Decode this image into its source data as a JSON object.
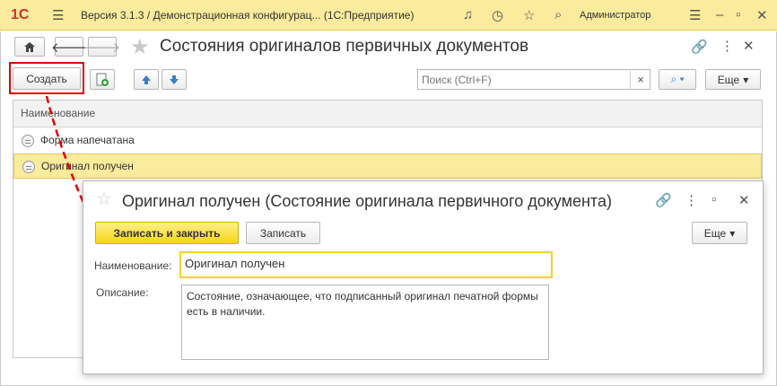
{
  "titlebar": {
    "logo": "1С",
    "title": "Версия 3.1.3 / Демонстрационная конфигурац...  (1С:Предприятие)",
    "user": "Администратор"
  },
  "page": {
    "title": "Состояния оригиналов первичных документов",
    "create_label": "Создать",
    "more_label": "Еще",
    "search_placeholder": "Поиск (Ctrl+F)",
    "clear_label": "×"
  },
  "table": {
    "header": "Наименование",
    "rows": [
      {
        "label": "Форма напечатана",
        "selected": false
      },
      {
        "label": "Оригинал получен",
        "selected": true
      }
    ]
  },
  "dialog": {
    "title": "Оригинал получен (Состояние оригинала первичного документа)",
    "save_close_label": "Записать и закрыть",
    "save_label": "Записать",
    "more_label": "Еще",
    "name_label": "Наименование:",
    "name_value": "Оригинал получен",
    "desc_label": "Описание:",
    "desc_value": "Состояние, означающее, что подписанный оригинал печатной формы есть в наличии."
  },
  "colors": {
    "accent": "#fbeb9c",
    "annotation": "#e60000",
    "primary_button": "#f5d512"
  }
}
